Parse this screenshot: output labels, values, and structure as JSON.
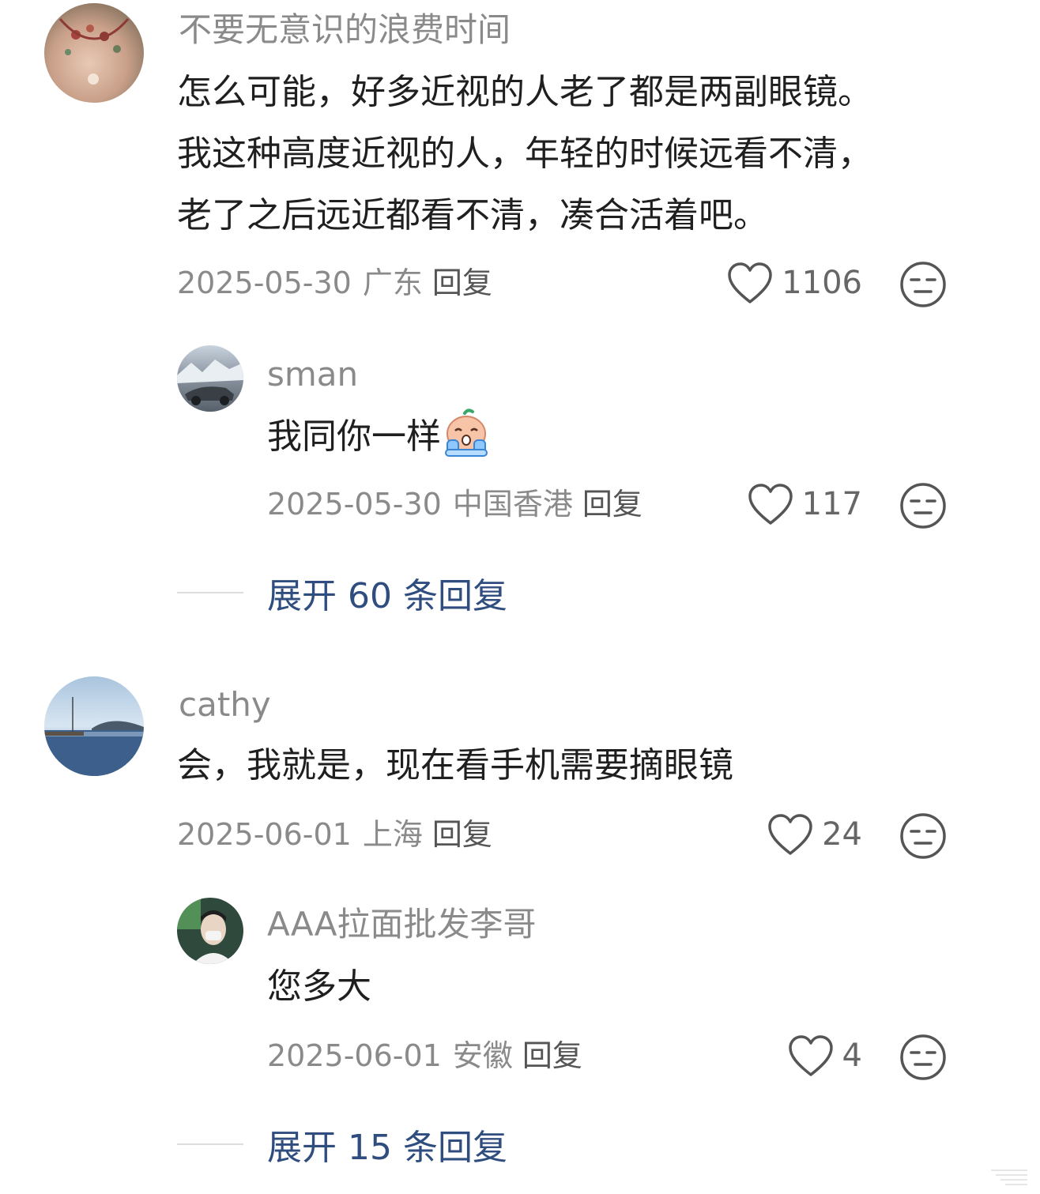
{
  "comments": [
    {
      "username": "不要无意识的浪费时间",
      "lines": [
        "怎么可能，好多近视的人老了都是两副眼镜。",
        "我这种高度近视的人，年轻的时候远看不清，",
        "老了之后远近都看不清，凑合活着吧。"
      ],
      "date": "2025-05-30",
      "location": "广东",
      "reply_label": "回复",
      "likes": "1106",
      "reply": {
        "username": "sman",
        "text": "我同你一样",
        "date": "2025-05-30",
        "location": "中国香港",
        "reply_label": "回复",
        "likes": "117"
      },
      "expand_label": "展开 60 条回复"
    },
    {
      "username": "cathy",
      "lines": [
        "会，我就是，现在看手机需要摘眼镜"
      ],
      "date": "2025-06-01",
      "location": "上海",
      "reply_label": "回复",
      "likes": "24",
      "reply": {
        "username": "AAA拉面批发李哥",
        "text": "您多大",
        "date": "2025-06-01",
        "location": "安徽",
        "reply_label": "回复",
        "likes": "4"
      },
      "expand_label": "展开 15 条回复"
    }
  ],
  "colors": {
    "link_blue": "#2f4d7e",
    "muted": "#8a8a8a",
    "text": "#1f1f1f"
  },
  "icons": [
    "heart-icon",
    "meh-face-icon",
    "crying-emoji"
  ]
}
